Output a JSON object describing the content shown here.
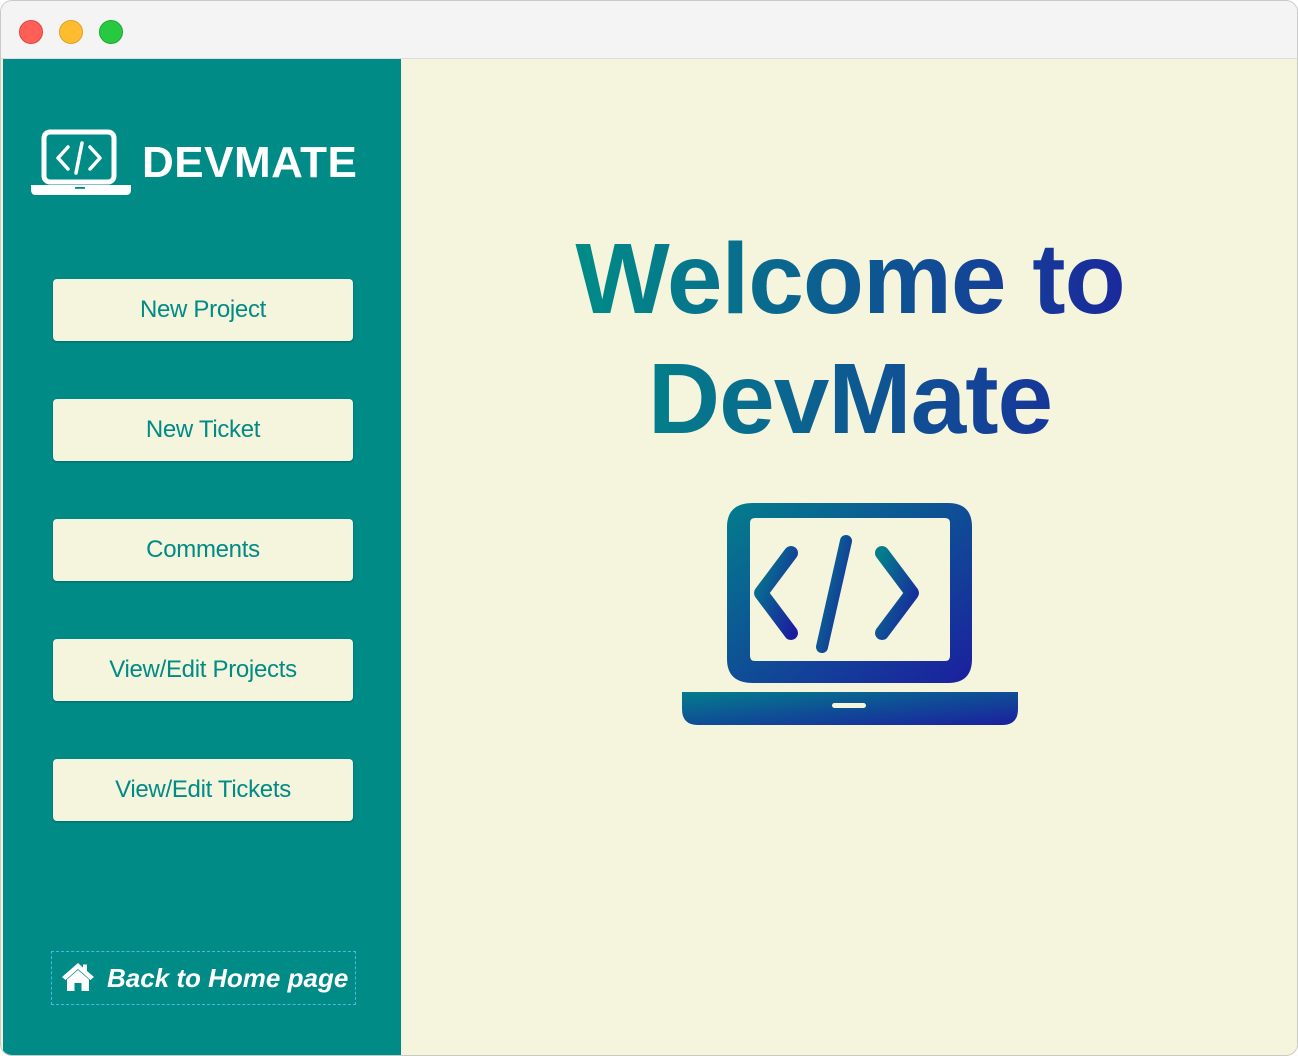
{
  "window": {
    "title": ""
  },
  "sidebar": {
    "brand_name": "DEVMATE",
    "brand_icon": "laptop-code-icon",
    "buttons": [
      {
        "label": "New Project"
      },
      {
        "label": "New Ticket"
      },
      {
        "label": "Comments"
      },
      {
        "label": "View/Edit Projects"
      },
      {
        "label": "View/Edit Tickets"
      }
    ],
    "home_link": {
      "label": "Back to Home page",
      "icon": "home-icon"
    }
  },
  "main": {
    "welcome_line1": "Welcome to",
    "welcome_line2": "DevMate",
    "hero_icon": "laptop-code-icon"
  },
  "colors": {
    "sidebar_bg": "#008b87",
    "content_bg": "#f5f4dc",
    "accent_teal": "#008b87",
    "accent_navy": "#1a2a9c",
    "button_text": "#008b87",
    "focus_dash": "#4ab6ea"
  }
}
